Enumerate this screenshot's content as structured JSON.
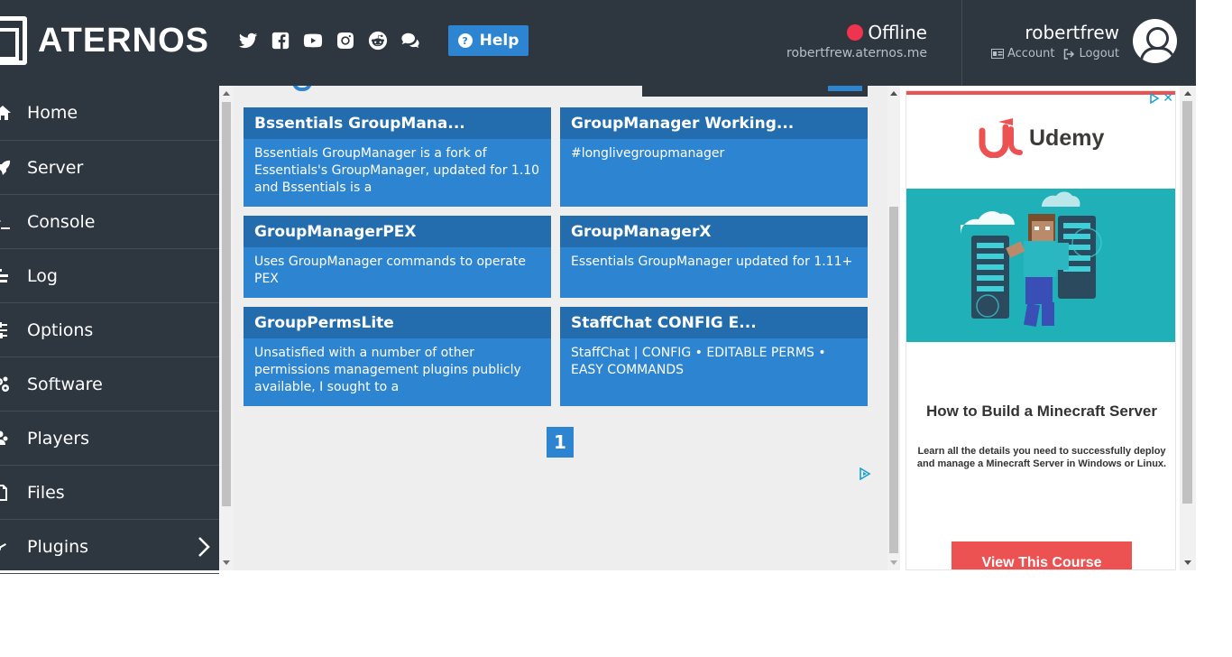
{
  "header": {
    "logo_text": "ATERNOS",
    "social_icons": [
      "twitter-icon",
      "facebook-icon",
      "youtube-icon",
      "instagram-icon",
      "reddit-icon",
      "chat-icon"
    ],
    "help_label": "Help",
    "status": {
      "label": "Offline",
      "color": "#f0334e",
      "address": "robertfrew.aternos.me"
    },
    "user": {
      "name": "robertfrew",
      "account_label": "Account",
      "logout_label": "Logout"
    }
  },
  "sidebar": {
    "items": [
      {
        "label": "Home",
        "icon": "home-icon"
      },
      {
        "label": "Server",
        "icon": "rocket-icon"
      },
      {
        "label": "Console",
        "icon": "terminal-icon"
      },
      {
        "label": "Log",
        "icon": "log-icon"
      },
      {
        "label": "Options",
        "icon": "sliders-icon"
      },
      {
        "label": "Software",
        "icon": "gears-icon"
      },
      {
        "label": "Players",
        "icon": "users-icon"
      },
      {
        "label": "Files",
        "icon": "file-icon"
      },
      {
        "label": "Plugins",
        "icon": "plug-icon"
      }
    ]
  },
  "plugins": [
    {
      "title": "Bssentials GroupMana...",
      "description": "Bssentials GroupManager is a fork of Essentials's GroupManager, updated for 1.10 and Bssentials is a"
    },
    {
      "title": "GroupManager Working...",
      "description": "#longlivegroupmanager"
    },
    {
      "title": "GroupManagerPEX",
      "description": "Uses GroupManager commands to operate PEX"
    },
    {
      "title": "GroupManagerX",
      "description": "Essentials GroupManager updated for 1.11+"
    },
    {
      "title": "GroupPermsLite",
      "description": "Unsatisfied with a number of other permissions management plugins publicly available, I sought to a"
    },
    {
      "title": "StaffChat CONFIG E...",
      "description": "StaffChat | CONFIG • EDITABLE PERMS • EASY COMMANDS"
    }
  ],
  "pagination": {
    "current": "1"
  },
  "ad": {
    "brand": "Udemy",
    "headline": "How to Build a Minecraft Server",
    "body": "Learn all the details you need to successfully deploy and manage a Minecraft Server in Windows or Linux.",
    "cta": "View This Course",
    "accent": "#ec5252"
  },
  "colors": {
    "header_bg": "#2e3640",
    "accent_blue": "#2d85d2",
    "card_title_bg": "#236dae",
    "content_bg": "#eeeeee"
  }
}
